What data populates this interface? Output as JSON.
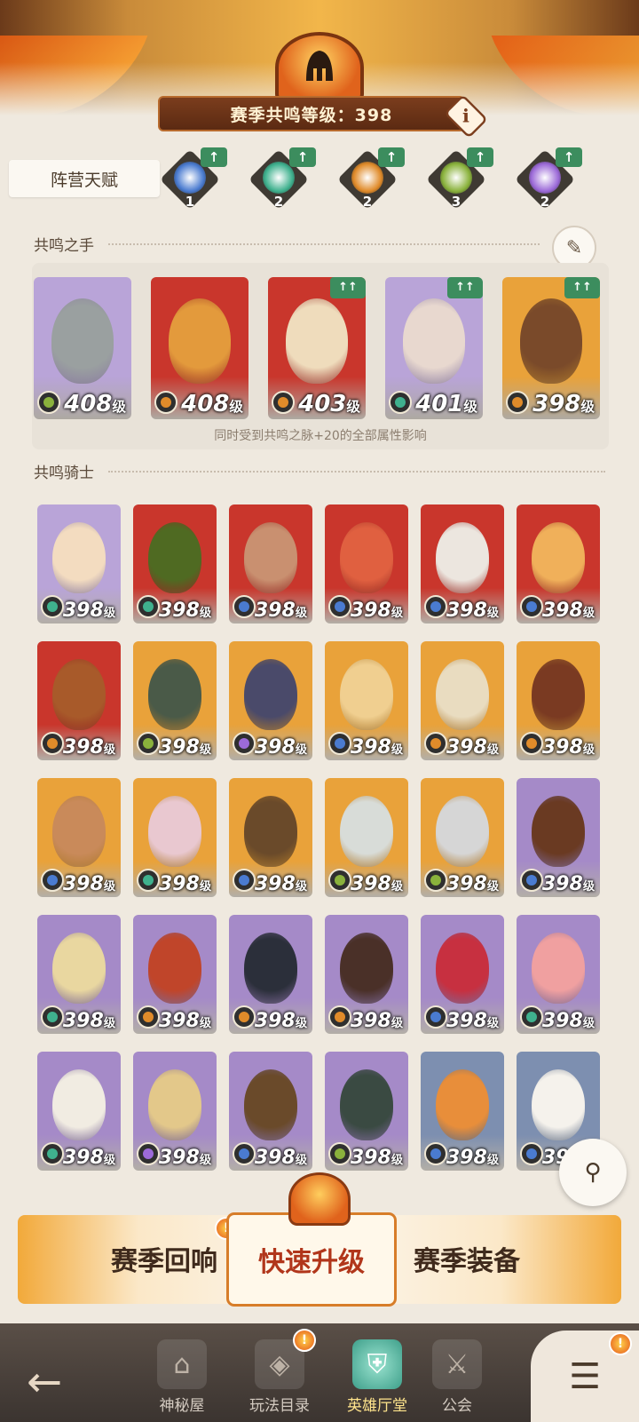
{
  "header": {
    "level_label": "赛季共鸣等级：398",
    "info_icon": "info-icon",
    "accent": "#7b3d1d"
  },
  "faction_talent": {
    "label": "阵营天赋",
    "items": [
      {
        "icon": "lightbearer-icon",
        "level": "1",
        "color": "#4a7bd0",
        "up": "↑"
      },
      {
        "icon": "wilder-icon",
        "level": "2",
        "color": "#3fb18e",
        "up": "↑"
      },
      {
        "icon": "mauler-icon",
        "level": "2",
        "color": "#e08b2a",
        "up": "↑"
      },
      {
        "icon": "graveborn-icon",
        "level": "3",
        "color": "#8ab23c",
        "up": "↑"
      },
      {
        "icon": "celestial-hypogean-icon",
        "level": "2",
        "color": "#9c6ad8",
        "up": "↑"
      }
    ]
  },
  "hand": {
    "title": "共鸣之手",
    "note": "同时受到共鸣之脉+20的全部属性影响",
    "cards": [
      {
        "level": "408",
        "unit": "级",
        "bg": "#b9a4d8",
        "skin": "#9aa0a0",
        "faction": "#8ab23c",
        "ups": ""
      },
      {
        "level": "408",
        "unit": "级",
        "bg": "#c9362c",
        "skin": "#e39a3c",
        "faction": "#e08b2a",
        "ups": ""
      },
      {
        "level": "403",
        "unit": "级",
        "bg": "#c9362c",
        "skin": "#efdcbc",
        "faction": "#e08b2a",
        "ups": "↑↑"
      },
      {
        "level": "401",
        "unit": "级",
        "bg": "#b9a4d8",
        "skin": "#e8d8cf",
        "faction": "#3fb18e",
        "ups": "↑↑"
      },
      {
        "level": "398",
        "unit": "级",
        "bg": "#e9a23a",
        "skin": "#7a4a2a",
        "faction": "#e08b2a",
        "ups": "↑↑"
      }
    ]
  },
  "knights": {
    "title": "共鸣骑士",
    "cards": [
      {
        "level": "398",
        "unit": "级",
        "bg": "#b9a4d8",
        "skin": "#f3dcc0",
        "faction": "#3fb18e"
      },
      {
        "level": "398",
        "unit": "级",
        "bg": "#c9362c",
        "skin": "#4f6a22",
        "faction": "#3fb18e"
      },
      {
        "level": "398",
        "unit": "级",
        "bg": "#c9362c",
        "skin": "#c99070",
        "faction": "#4a7bd0"
      },
      {
        "level": "398",
        "unit": "级",
        "bg": "#c9362c",
        "skin": "#e06040",
        "faction": "#4a7bd0"
      },
      {
        "level": "398",
        "unit": "级",
        "bg": "#c9362c",
        "skin": "#ece6df",
        "faction": "#4a7bd0"
      },
      {
        "level": "398",
        "unit": "级",
        "bg": "#c9362c",
        "skin": "#f0b05a",
        "faction": "#4a7bd0"
      },
      {
        "level": "398",
        "unit": "级",
        "bg": "#c9362c",
        "skin": "#a85a2a",
        "faction": "#e08b2a"
      },
      {
        "level": "398",
        "unit": "级",
        "bg": "#e9a23a",
        "skin": "#4a5a48",
        "faction": "#8ab23c"
      },
      {
        "level": "398",
        "unit": "级",
        "bg": "#e9a23a",
        "skin": "#4a4a6a",
        "faction": "#9c6ad8"
      },
      {
        "level": "398",
        "unit": "级",
        "bg": "#e9a23a",
        "skin": "#f0cf90",
        "faction": "#4a7bd0"
      },
      {
        "level": "398",
        "unit": "级",
        "bg": "#e9a23a",
        "skin": "#e9dcc0",
        "faction": "#e08b2a"
      },
      {
        "level": "398",
        "unit": "级",
        "bg": "#e9a23a",
        "skin": "#7a3a22",
        "faction": "#e08b2a"
      },
      {
        "level": "398",
        "unit": "级",
        "bg": "#e9a23a",
        "skin": "#c98a5a",
        "faction": "#4a7bd0"
      },
      {
        "level": "398",
        "unit": "级",
        "bg": "#e9a23a",
        "skin": "#e9c8d0",
        "faction": "#3fb18e"
      },
      {
        "level": "398",
        "unit": "级",
        "bg": "#e9a23a",
        "skin": "#6a4a2a",
        "faction": "#4a7bd0"
      },
      {
        "level": "398",
        "unit": "级",
        "bg": "#e9a23a",
        "skin": "#d8dcd8",
        "faction": "#8ab23c"
      },
      {
        "level": "398",
        "unit": "级",
        "bg": "#e9a23a",
        "skin": "#d6d6d6",
        "faction": "#8ab23c"
      },
      {
        "level": "398",
        "unit": "级",
        "bg": "#a58ac8",
        "skin": "#6a3a22",
        "faction": "#4a7bd0"
      },
      {
        "level": "398",
        "unit": "级",
        "bg": "#a58ac8",
        "skin": "#e9d7a0",
        "faction": "#3fb18e"
      },
      {
        "level": "398",
        "unit": "级",
        "bg": "#a58ac8",
        "skin": "#c0452a",
        "faction": "#e08b2a"
      },
      {
        "level": "398",
        "unit": "级",
        "bg": "#a58ac8",
        "skin": "#2b2f3a",
        "faction": "#e08b2a"
      },
      {
        "level": "398",
        "unit": "级",
        "bg": "#a58ac8",
        "skin": "#4a3028",
        "faction": "#e08b2a"
      },
      {
        "level": "398",
        "unit": "级",
        "bg": "#a58ac8",
        "skin": "#c73040",
        "faction": "#4a7bd0"
      },
      {
        "level": "398",
        "unit": "级",
        "bg": "#a58ac8",
        "skin": "#f0a0a0",
        "faction": "#3fb18e"
      },
      {
        "level": "398",
        "unit": "级",
        "bg": "#a58ac8",
        "skin": "#f1ece2",
        "faction": "#3fb18e"
      },
      {
        "level": "398",
        "unit": "级",
        "bg": "#a58ac8",
        "skin": "#e3c88a",
        "faction": "#9c6ad8"
      },
      {
        "level": "398",
        "unit": "级",
        "bg": "#a58ac8",
        "skin": "#6a4a2a",
        "faction": "#4a7bd0"
      },
      {
        "level": "398",
        "unit": "级",
        "bg": "#a58ac8",
        "skin": "#3a4a42",
        "faction": "#8ab23c"
      },
      {
        "level": "398",
        "unit": "级",
        "bg": "#7d8fb0",
        "skin": "#e88e3a",
        "faction": "#4a7bd0"
      },
      {
        "level": "398",
        "unit": "级",
        "bg": "#7d8fb0",
        "skin": "#f5f2ec",
        "faction": "#4a7bd0"
      }
    ]
  },
  "action_bar": {
    "left": "赛季回响",
    "center": "快速升级",
    "right": "赛季装备",
    "alert": "!"
  },
  "nav": {
    "items": [
      {
        "label": "神秘屋",
        "icon": "mystery-house-icon",
        "glyph": "⌂",
        "alert": ""
      },
      {
        "label": "玩法目录",
        "icon": "game-modes-icon",
        "glyph": "◈",
        "alert": "!"
      },
      {
        "label": "英雄厅堂",
        "icon": "hero-hall-icon",
        "glyph": "⛨",
        "alert": ""
      },
      {
        "label": "公会",
        "icon": "guild-icon",
        "glyph": "⚔",
        "alert": ""
      }
    ],
    "menu_alert": "!"
  }
}
